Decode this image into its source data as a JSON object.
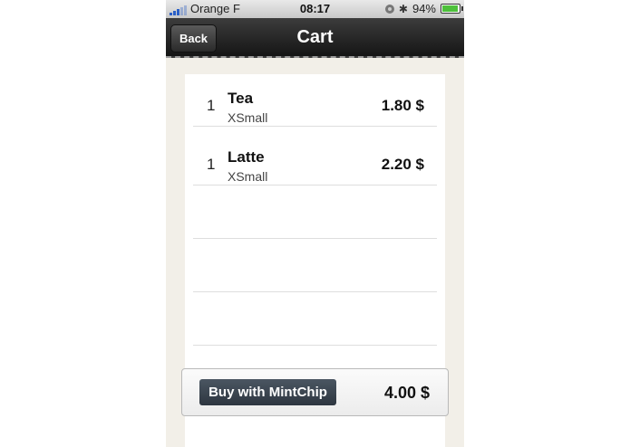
{
  "status_bar": {
    "carrier": "Orange F",
    "time": "08:17",
    "battery": "94%",
    "battery_level": 0.94,
    "icons": [
      "signal-icon",
      "lock-rotation-icon",
      "bluetooth-icon",
      "battery-icon"
    ]
  },
  "nav": {
    "back_label": "Back",
    "title": "Cart"
  },
  "cart": {
    "items": [
      {
        "qty": "1",
        "name": "Tea",
        "size": "XSmall",
        "price": "1.80 $"
      },
      {
        "qty": "1",
        "name": "Latte",
        "size": "XSmall",
        "price": "2.20 $"
      }
    ],
    "empty_rows": 3
  },
  "footer": {
    "buy_label": "Buy with MintChip",
    "total": "4.00 $"
  },
  "colors": {
    "nav_bar": "#222222",
    "background": "#f2efe8",
    "buy_button": "#3a434e",
    "battery_fill": "#4dc03b"
  }
}
